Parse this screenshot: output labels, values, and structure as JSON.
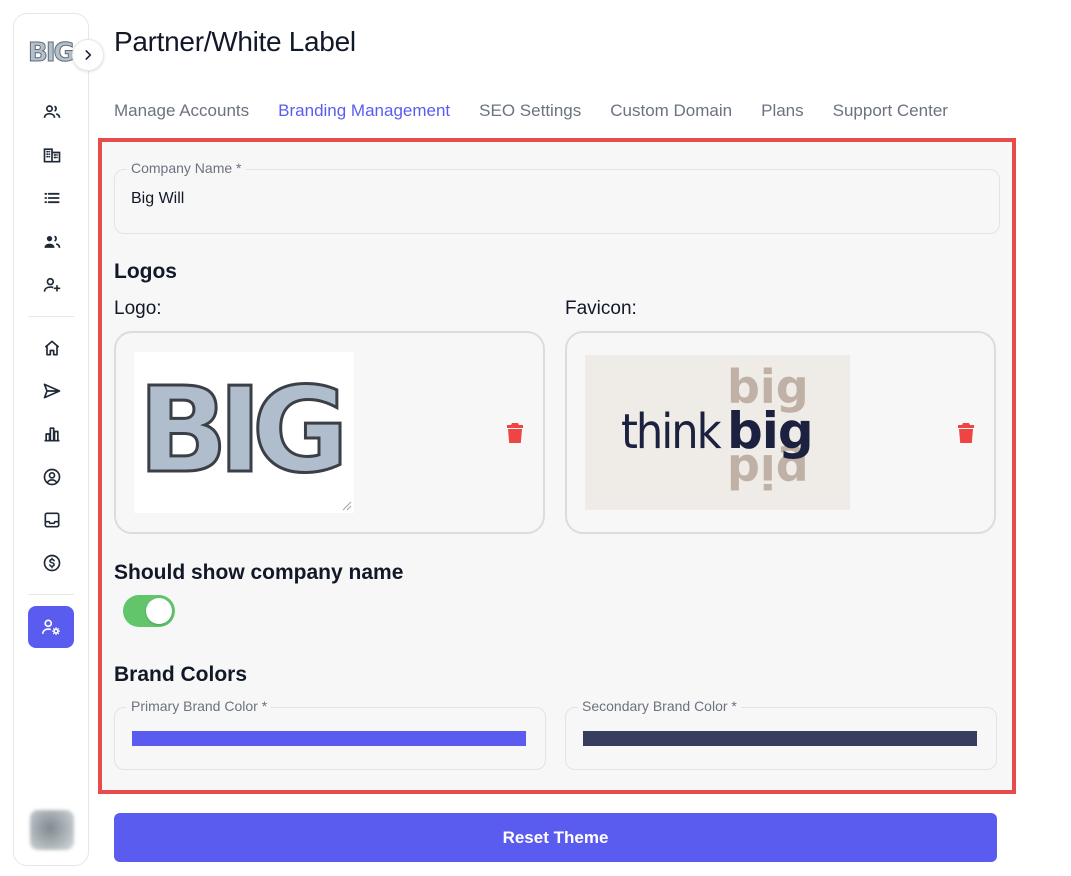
{
  "sidebar": {
    "logo_text": "BIG",
    "items": [
      {
        "icon": "users-icon"
      },
      {
        "icon": "building-icon"
      },
      {
        "icon": "list-icon"
      },
      {
        "icon": "team-icon"
      },
      {
        "icon": "add-user-icon"
      },
      {
        "icon": "home-icon"
      },
      {
        "icon": "send-icon"
      },
      {
        "icon": "bar-chart-icon"
      },
      {
        "icon": "user-circle-icon"
      },
      {
        "icon": "inbox-icon"
      },
      {
        "icon": "dollar-icon"
      },
      {
        "icon": "user-settings-icon",
        "active": true
      }
    ]
  },
  "header": {
    "title": "Partner/White Label"
  },
  "tabs": [
    {
      "label": "Manage Accounts",
      "active": false
    },
    {
      "label": "Branding Management",
      "active": true
    },
    {
      "label": "SEO Settings",
      "active": false
    },
    {
      "label": "Custom Domain",
      "active": false
    },
    {
      "label": "Plans",
      "active": false
    },
    {
      "label": "Support Center",
      "active": false
    }
  ],
  "branding": {
    "company_name": {
      "label": "Company Name *",
      "value": "Big Will"
    },
    "logos_heading": "Logos",
    "logo": {
      "label": "Logo:",
      "image_text": "BIG"
    },
    "favicon": {
      "label": "Favicon:",
      "image_text_think": "think",
      "image_text_big": "big"
    },
    "show_company_name": {
      "heading": "Should show company name",
      "enabled": true
    },
    "brand_colors_heading": "Brand Colors",
    "primary_color": {
      "label": "Primary Brand Color *",
      "value": "#5a5cf0"
    },
    "secondary_color": {
      "label": "Secondary Brand Color *",
      "value": "#373d5e"
    }
  },
  "actions": {
    "reset_label": "Reset Theme"
  },
  "colors": {
    "accent": "#5a5cf0",
    "highlight_border": "#e84b4b",
    "delete": "#ef4444",
    "toggle_on": "#62c46b"
  }
}
